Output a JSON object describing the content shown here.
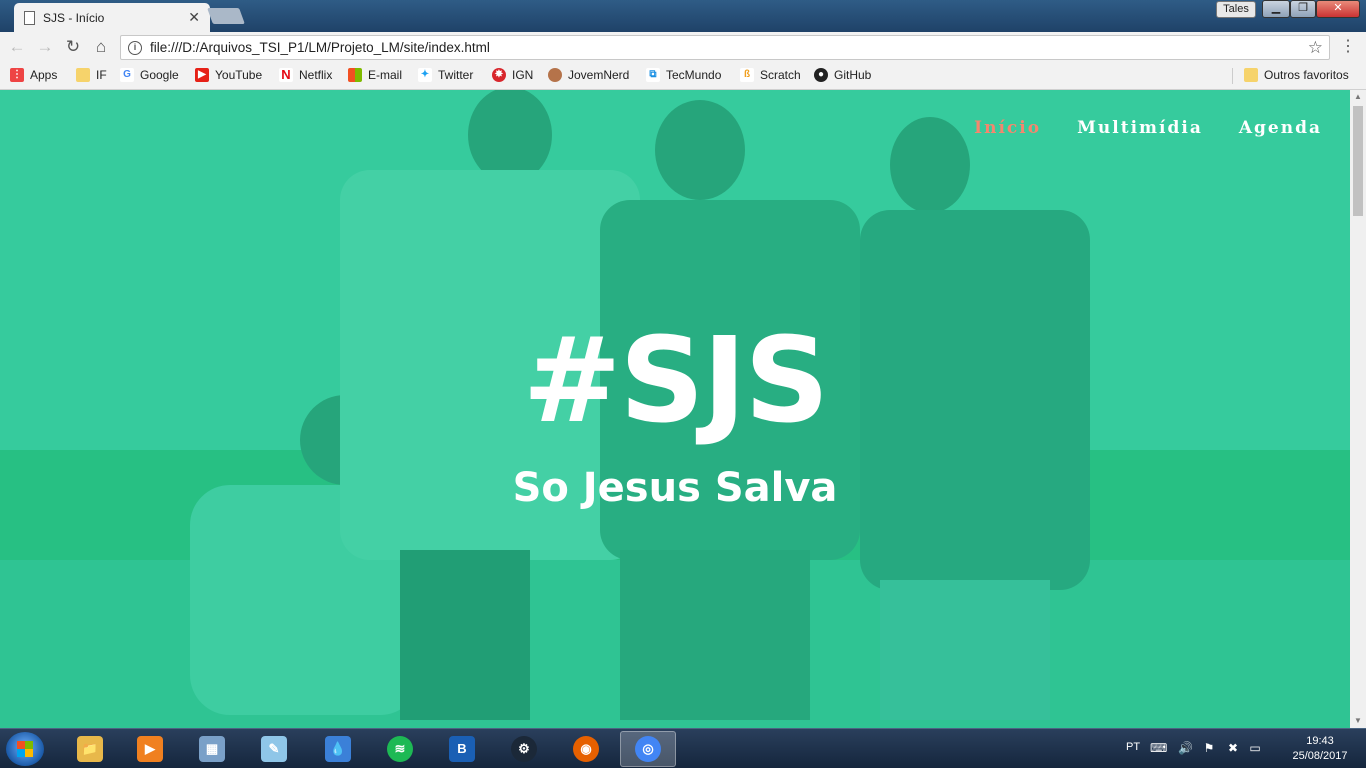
{
  "browser": {
    "tab_title": "SJS - Início",
    "tab_close": "✕",
    "user": "Tales",
    "url": "file:///D:/Arquivos_TSI_P1/LM/Projeto_LM/site/index.html"
  },
  "bookmarks": {
    "items": [
      {
        "label": "Apps",
        "icon": "apps-grid-icon",
        "color": "#e44"
      },
      {
        "label": "IF",
        "icon": "folder-icon",
        "color": "#f6d36b"
      },
      {
        "label": "Google",
        "icon": "google-icon",
        "color": "#4285f4"
      },
      {
        "label": "YouTube",
        "icon": "youtube-icon",
        "color": "#e62117"
      },
      {
        "label": "Netflix",
        "icon": "netflix-icon",
        "color": "#e50914"
      },
      {
        "label": "E-mail",
        "icon": "windows-mail-icon",
        "color": "#0078d7"
      },
      {
        "label": "Twitter",
        "icon": "twitter-icon",
        "color": "#1da1f2"
      },
      {
        "label": "IGN",
        "icon": "ign-icon",
        "color": "#d8262c"
      },
      {
        "label": "JovemNerd",
        "icon": "jovemnerd-icon",
        "color": "#b5734a"
      },
      {
        "label": "TecMundo",
        "icon": "tecmundo-icon",
        "color": "#1a8fe3"
      },
      {
        "label": "Scratch",
        "icon": "scratch-icon",
        "color": "#f0a020"
      },
      {
        "label": "GitHub",
        "icon": "github-icon",
        "color": "#222222"
      }
    ],
    "other": "Outros favoritos"
  },
  "site": {
    "nav": [
      {
        "label": "Início",
        "active": true
      },
      {
        "label": "Multimídia",
        "active": false
      },
      {
        "label": "Agenda",
        "active": false
      }
    ],
    "hero_title": "#SJS",
    "hero_subtitle": "So Jesus Salva",
    "overlay_color": "#2cc79a",
    "active_nav_color": "#f4876e"
  },
  "taskbar": {
    "apps": [
      {
        "name": "file-explorer",
        "glyph": "📁",
        "color": "#e8b84a",
        "active": false
      },
      {
        "name": "media-player",
        "glyph": "▶",
        "color": "#f08020",
        "active": false
      },
      {
        "name": "calculator",
        "glyph": "▦",
        "color": "#7aa0c8",
        "active": false
      },
      {
        "name": "notepad",
        "glyph": "✎",
        "color": "#8fc6e8",
        "active": false
      },
      {
        "name": "drop-app",
        "glyph": "💧",
        "color": "#3b80d8",
        "active": false
      },
      {
        "name": "spotify",
        "glyph": "≋",
        "color": "#1db954",
        "active": false
      },
      {
        "name": "blizzard",
        "glyph": "B",
        "color": "#1a5fb4",
        "active": false
      },
      {
        "name": "steam",
        "glyph": "⚙",
        "color": "#1b2838",
        "active": false
      },
      {
        "name": "firefox",
        "glyph": "◉",
        "color": "#e66000",
        "active": false
      },
      {
        "name": "chrome",
        "glyph": "◎",
        "color": "#4285f4",
        "active": true
      }
    ],
    "language": "PT",
    "time": "19:43",
    "date": "25/08/2017"
  }
}
